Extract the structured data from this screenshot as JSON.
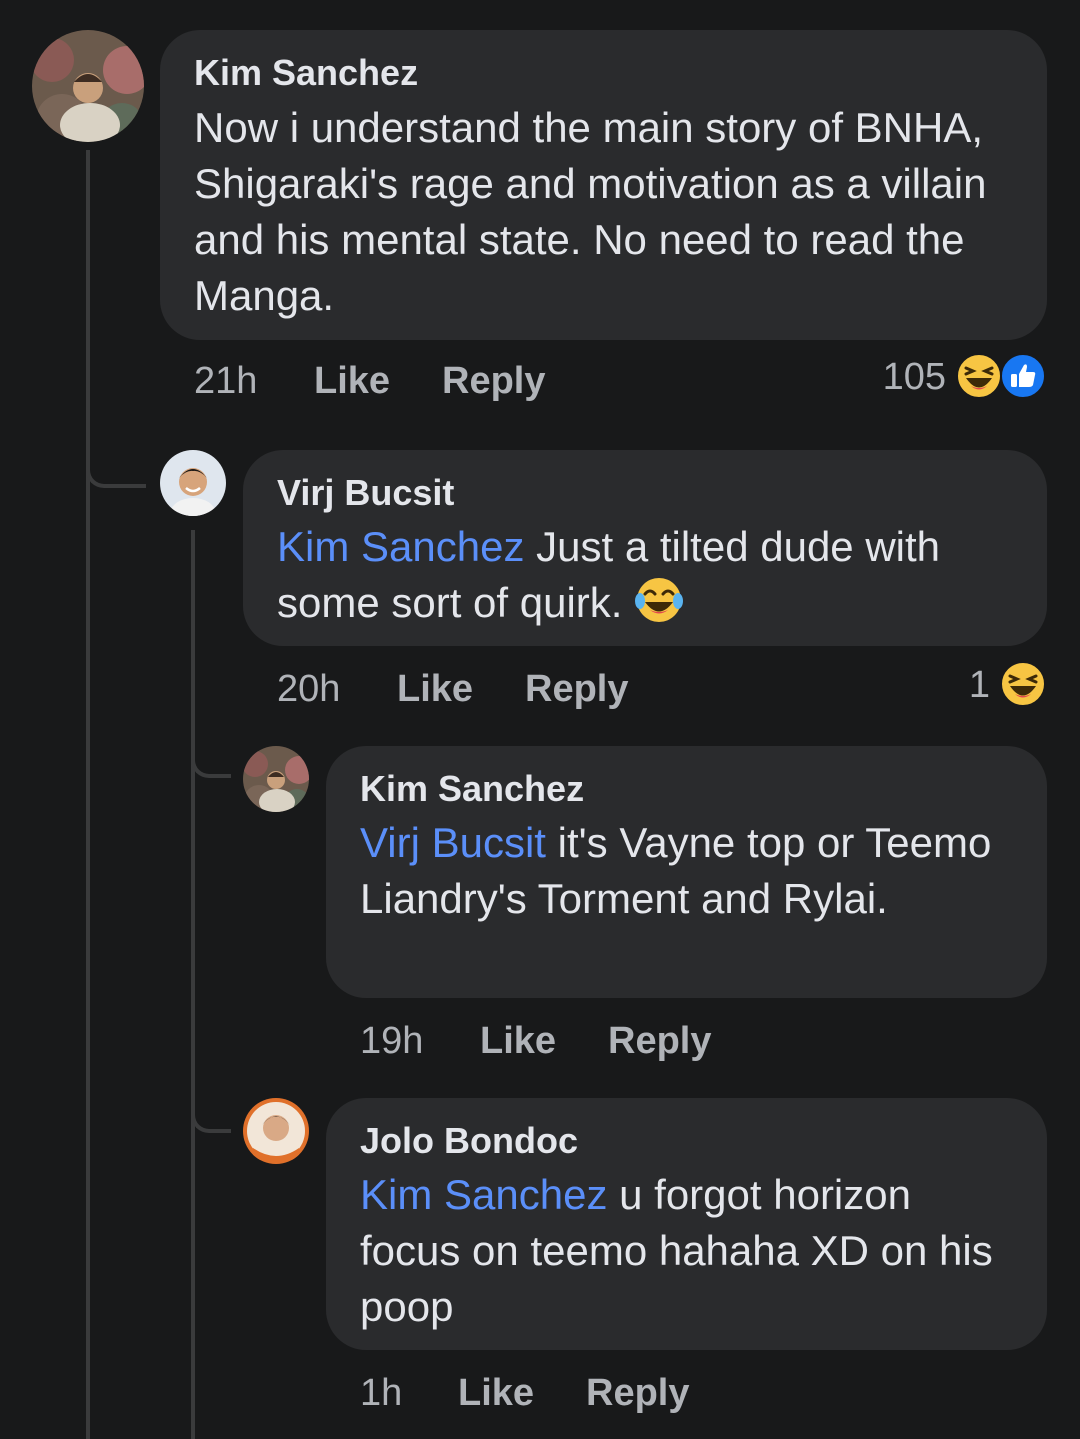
{
  "comments": [
    {
      "author": "Kim Sanchez",
      "text": "Now i understand the main story of BNHA, Shigaraki's rage and motivation as a villain and his mental state. No need to read the Manga.",
      "time": "21h",
      "like_label": "Like",
      "reply_label": "Reply",
      "reaction_count": "105",
      "reactions": [
        "haha-icon",
        "like-icon"
      ]
    },
    {
      "author": "Virj Bucsit",
      "mention": "Kim Sanchez",
      "text": "Just a tilted dude with some sort of quirk.",
      "emoji": "tears-of-joy-emoji",
      "time": "20h",
      "like_label": "Like",
      "reply_label": "Reply",
      "reaction_count": "1",
      "reactions": [
        "haha-icon"
      ]
    },
    {
      "author": "Kim Sanchez",
      "mention": "Virj Bucsit",
      "text": "it's Vayne top or Teemo Liandry's Torment and Rylai.",
      "time": "19h",
      "like_label": "Like",
      "reply_label": "Reply"
    },
    {
      "author": "Jolo Bondoc",
      "mention": "Kim Sanchez",
      "text": "u forgot horizon focus on teemo hahaha XD on his poop",
      "time": "1h",
      "like_label": "Like",
      "reply_label": "Reply"
    }
  ],
  "colors": {
    "background": "#18191a",
    "bubble": "#2a2b2d",
    "mention": "#5b8ff9",
    "secondary_text": "#b0b3b8",
    "like_blue": "#1877f2",
    "haha_yellow": "#f7c543"
  }
}
